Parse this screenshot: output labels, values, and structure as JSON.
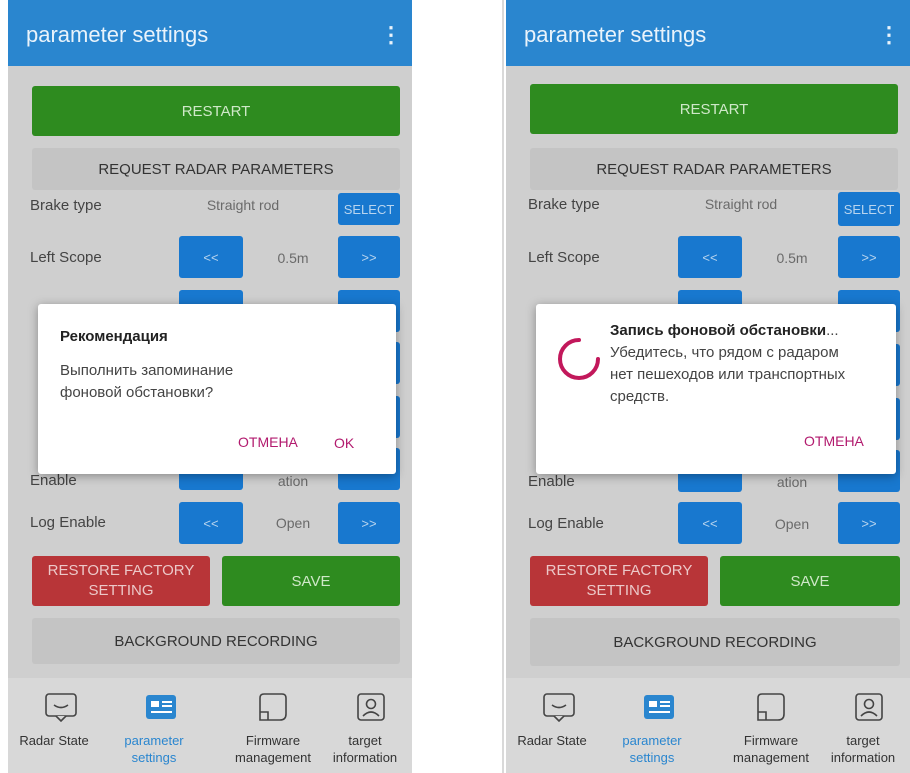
{
  "appbar": {
    "title": "parameter settings",
    "menu_glyph": "⋮"
  },
  "buttons": {
    "restart": "RESTART",
    "request": "REQUEST RADAR PARAMETERS",
    "select": "SELECT",
    "prev": "<<",
    "next": ">>",
    "restore_line1": "RESTORE FACTORY",
    "restore_line2": "SETTING",
    "save": "SAVE",
    "background_recording": "BACKGROUND RECORDING"
  },
  "rows": {
    "brake_type": {
      "label": "Brake type",
      "value": "Straight rod"
    },
    "left_scope": {
      "label": "Left Scope",
      "value": "0.5m"
    },
    "enable_partial_label": "Enable",
    "enable_partial_value": "ation",
    "log_enable": {
      "label": "Log Enable",
      "value": "Open"
    }
  },
  "dialog_confirm": {
    "title": "Рекомендация",
    "text_line1": "Выполнить запоминание",
    "text_line2": "фоновой обстановки?",
    "cancel": "ОТМЕНА",
    "ok": "OK"
  },
  "dialog_progress": {
    "title": "Запись фоновой обстановки",
    "ellipsis": "...",
    "text_line1": "Убедитесь, что рядом с радаром",
    "text_line2": "нет пешеходов или транспортных",
    "text_line3": "средств.",
    "cancel": "ОТМЕНА"
  },
  "bottom_nav": {
    "radar_state": "Radar State",
    "parameter_line1": "parameter",
    "parameter_line2": "settings",
    "firmware_line1": "Firmware",
    "firmware_line2": "management",
    "target_line1": "target",
    "target_line2": "information"
  },
  "colors": {
    "appbar": "#2a86cf",
    "accent_green": "#2e8b1f",
    "accent_blue": "#1878cf",
    "accent_red": "#b83538",
    "dialog_button": "#b21a6e"
  }
}
